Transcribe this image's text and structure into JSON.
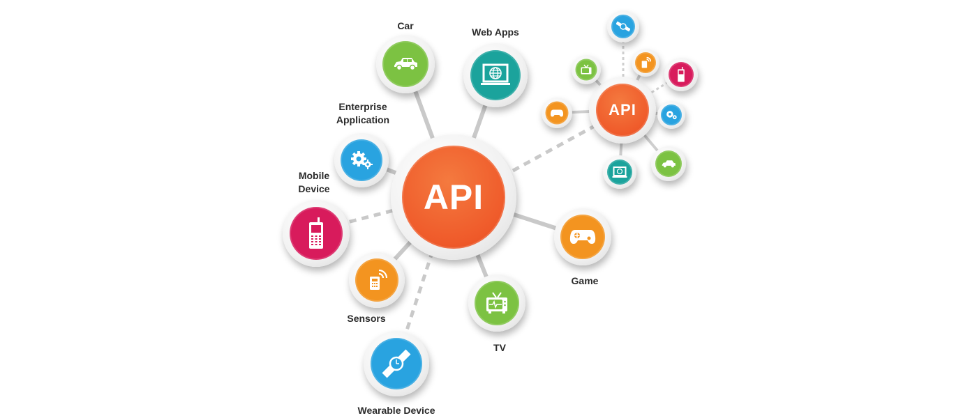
{
  "main_hub": {
    "label": "API",
    "color": "#ef5a2a"
  },
  "nodes": [
    {
      "id": "car",
      "label": "Car",
      "icon": "car-icon",
      "color": "#7cc242"
    },
    {
      "id": "web-apps",
      "label": "Web Apps",
      "icon": "laptop-globe-icon",
      "color": "#1ba39c"
    },
    {
      "id": "enterprise-application",
      "label": "Enterprise\nApplication",
      "label_line1": "Enterprise",
      "label_line2": "Application",
      "icon": "gears-icon",
      "color": "#29a3e0"
    },
    {
      "id": "mobile-device",
      "label_line1": "Mobile",
      "label_line2": "Device",
      "icon": "mobile-phone-icon",
      "color": "#d81b5c"
    },
    {
      "id": "sensors",
      "label": "Sensors",
      "icon": "sensor-icon",
      "color": "#f39420"
    },
    {
      "id": "wearable-device",
      "label": "Wearable Device",
      "icon": "watch-icon",
      "color": "#29a3e0"
    },
    {
      "id": "tv",
      "label": "TV",
      "icon": "tv-icon",
      "color": "#7cc242"
    },
    {
      "id": "game",
      "label": "Game",
      "icon": "gamepad-icon",
      "color": "#f39420"
    }
  ],
  "mini_hub": {
    "label": "API",
    "color": "#ef5a2a"
  },
  "mini_nodes": [
    {
      "id": "mini-watch",
      "icon": "watch-icon",
      "color": "#29a3e0"
    },
    {
      "id": "mini-sensor",
      "icon": "sensor-icon",
      "color": "#f39420"
    },
    {
      "id": "mini-mobile",
      "icon": "mobile-phone-icon",
      "color": "#d81b5c"
    },
    {
      "id": "mini-gears",
      "icon": "gears-icon",
      "color": "#29a3e0"
    },
    {
      "id": "mini-car",
      "icon": "car-icon",
      "color": "#7cc242"
    },
    {
      "id": "mini-laptop",
      "icon": "laptop-globe-icon",
      "color": "#1ba39c"
    },
    {
      "id": "mini-game",
      "icon": "gamepad-icon",
      "color": "#f39420"
    },
    {
      "id": "mini-tv",
      "icon": "tv-icon",
      "color": "#7cc242"
    }
  ]
}
